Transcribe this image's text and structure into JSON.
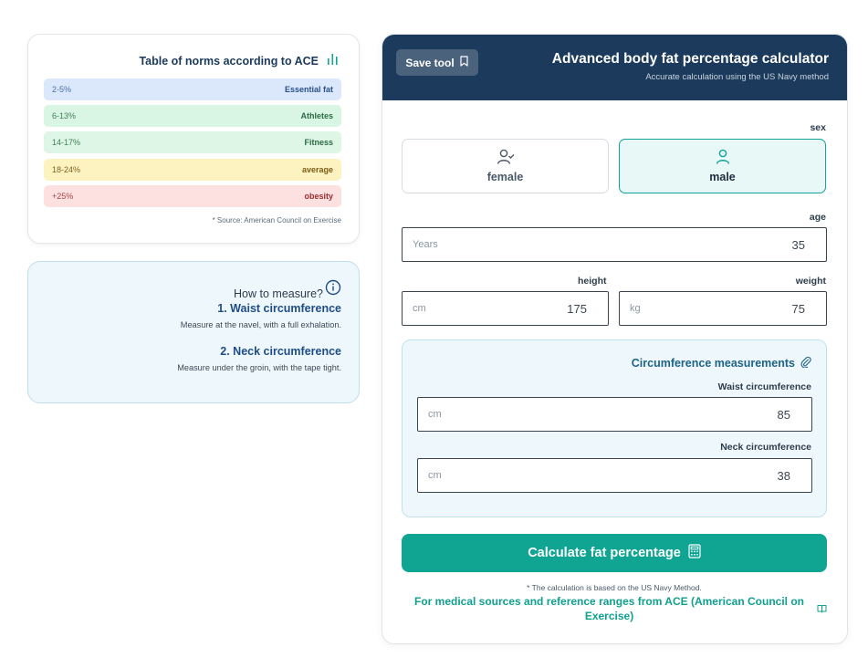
{
  "norms": {
    "title": "Table of norms according to ACE",
    "icon": "bar-chart-icon",
    "rows": [
      {
        "range": "2-5%",
        "label": "Essential fat",
        "bg": "#dbe8fb",
        "range_color": "#4a6fa5",
        "label_color": "#2a4f8a"
      },
      {
        "range": "6-13%",
        "label": "Athletes",
        "bg": "#d9f5e3",
        "range_color": "#3f7f58",
        "label_color": "#2c6b45"
      },
      {
        "range": "14-17%",
        "label": "Fitness",
        "bg": "#ddf6e5",
        "range_color": "#3f7f58",
        "label_color": "#2c6b45"
      },
      {
        "range": "18-24%",
        "label": "average",
        "bg": "#fdf3c1",
        "range_color": "#7d6420",
        "label_color": "#7a5c13"
      },
      {
        "range": "+25%",
        "label": "obesity",
        "bg": "#fde0e0",
        "range_color": "#a54848",
        "label_color": "#9b2f2f"
      }
    ],
    "source": "* Source: American Council on Exercise"
  },
  "measure": {
    "title": "How to measure?",
    "icon": "info-icon",
    "steps": [
      {
        "title": "1. Waist circumference",
        "desc": "Measure at the navel, with a full exhalation."
      },
      {
        "title": "2. Neck circumference",
        "desc": "Measure under the groin, with the tape tight."
      }
    ]
  },
  "calculator": {
    "save_label": "Save tool",
    "title": "Advanced body fat percentage calculator",
    "subtitle": "Accurate calculation using the US Navy method",
    "sex_label": "sex",
    "female_label": "female",
    "male_label": "male",
    "selected_sex": "male",
    "age_label": "age",
    "age_unit": "Years",
    "age_value": "35",
    "height_label": "height",
    "height_unit": "cm",
    "height_value": "175",
    "weight_label": "weight",
    "weight_unit": "kg",
    "weight_value": "75",
    "circ_title": "Circumference measurements",
    "waist_label": "Waist circumference",
    "waist_unit": "cm",
    "waist_value": "85",
    "neck_label": "Neck circumference",
    "neck_unit": "cm",
    "neck_value": "38",
    "calc_label": "Calculate fat percentage",
    "footnote": "* The calculation is based on the US Navy Method.",
    "sources_link": "For medical sources and reference ranges from ACE (American Council on Exercise)"
  },
  "colors": {
    "header": "#1b3a5c",
    "accent": "#0fa592",
    "info_blue": "#1e4d86"
  }
}
